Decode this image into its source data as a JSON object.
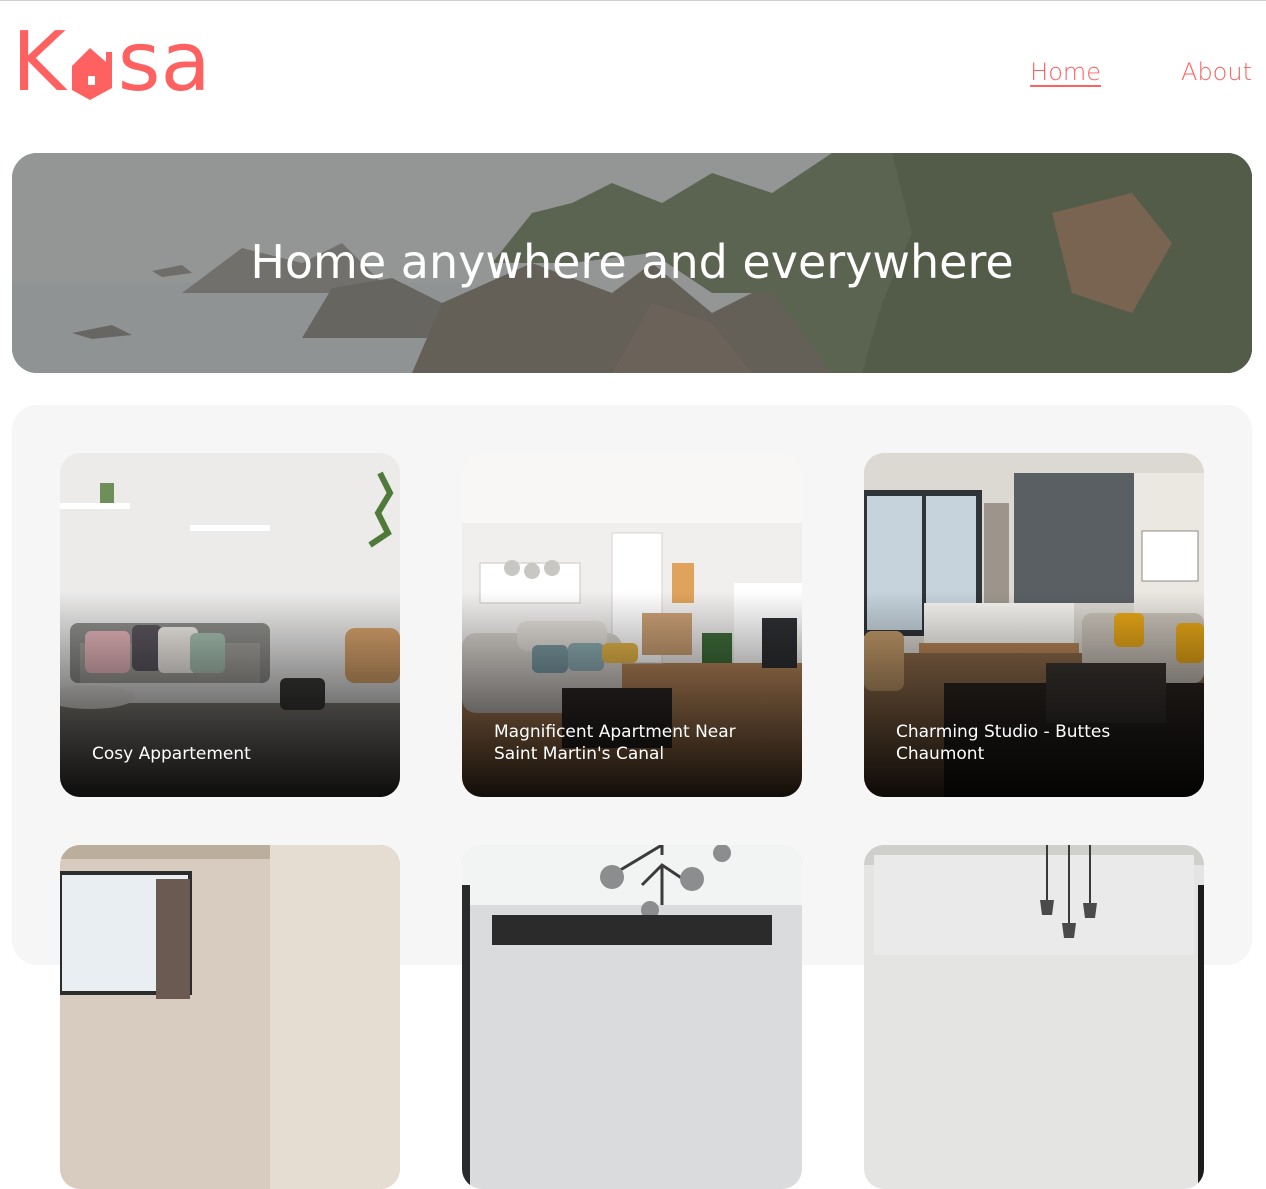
{
  "brand": {
    "logo_letters_left": "K",
    "logo_letters_right": "sa",
    "logo_icon": "house-icon",
    "accent_color": "#FF6060"
  },
  "nav": {
    "home_label": "Home",
    "about_label": "About"
  },
  "banner": {
    "title": "Home anywhere and everywhere"
  },
  "listings": [
    {
      "title": "Cosy Appartement"
    },
    {
      "title": "Magnificent Apartment Near Saint Martin's Canal"
    },
    {
      "title": "Charming Studio - Buttes Chaumont"
    },
    {
      "title": ""
    },
    {
      "title": ""
    },
    {
      "title": ""
    }
  ]
}
